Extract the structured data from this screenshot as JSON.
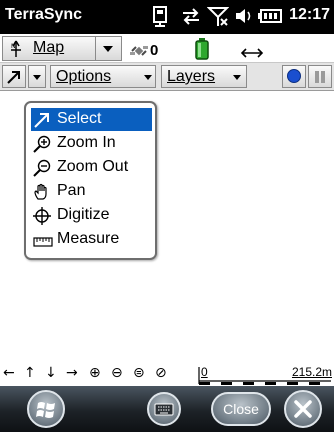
{
  "status_bar": {
    "app_title": "TerraSync",
    "clock": "12:17",
    "icons": [
      "sync-device-icon",
      "connectivity-icon",
      "signal-off-icon",
      "volume-icon",
      "battery-icon"
    ]
  },
  "map_row": {
    "mode_label": "Map",
    "mode_icon": "north-arrow-icon",
    "satellite_icon": "satellite-icon",
    "satellite_count": "0",
    "status_icons": [
      "battery-level-icon",
      "horizontal-arrows-icon"
    ]
  },
  "toolbar": {
    "current_tool_icon": "select-arrow-icon",
    "options_label": "Options",
    "layers_label": "Layers",
    "record_icon": "record-icon",
    "pause_icon": "pause-icon"
  },
  "tool_menu": {
    "items": [
      {
        "label": "Select",
        "icon": "select-arrow-icon",
        "selected": true
      },
      {
        "label": "Zoom In",
        "icon": "zoom-in-icon",
        "selected": false
      },
      {
        "label": "Zoom Out",
        "icon": "zoom-out-icon",
        "selected": false
      },
      {
        "label": "Pan",
        "icon": "hand-icon",
        "selected": false
      },
      {
        "label": "Digitize",
        "icon": "crosshair-icon",
        "selected": false
      },
      {
        "label": "Measure",
        "icon": "ruler-icon",
        "selected": false
      }
    ]
  },
  "nav_bar": {
    "buttons": [
      "←",
      "↑",
      "↓",
      "→",
      "⊕",
      "⊖",
      "⊜",
      "⊘"
    ],
    "scale_start": "0",
    "scale_end": "215.2m"
  },
  "command_bar": {
    "close_label": "Close",
    "icons": [
      "windows-start-icon",
      "keyboard-icon",
      "close-x-icon"
    ]
  },
  "colors": {
    "selection": "#0a5fbf",
    "record": "#1a4fcf",
    "title_bar": "#000000"
  }
}
